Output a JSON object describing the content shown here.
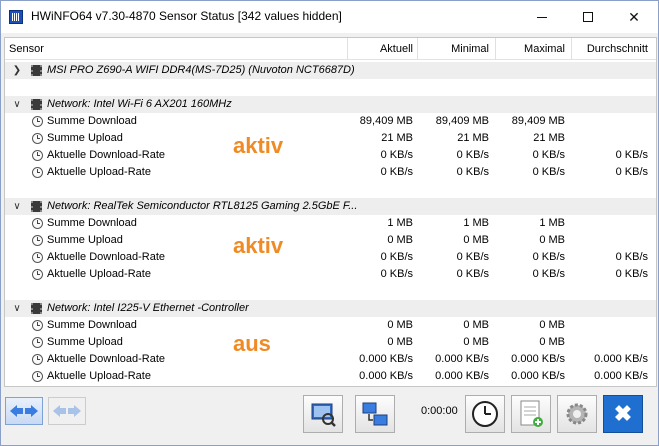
{
  "window": {
    "title": "HWiNFO64 v7.30-4870 Sensor Status [342 values hidden]"
  },
  "columns": {
    "sensor": "Sensor",
    "current": "Aktuell",
    "minimum": "Minimal",
    "maximum": "Maximal",
    "average": "Durchschnitt"
  },
  "groups": [
    {
      "name": "MSI PRO Z690-A WIFI DDR4(MS-7D25) (Nuvoton NCT6687D)",
      "expanded": false,
      "rows": []
    },
    {
      "name": "Network: Intel Wi-Fi 6 AX201 160MHz",
      "expanded": true,
      "rows": [
        {
          "label": "Summe Download",
          "cur": "89,409 MB",
          "min": "89,409 MB",
          "max": "89,409 MB",
          "avg": ""
        },
        {
          "label": "Summe Upload",
          "cur": "21 MB",
          "min": "21 MB",
          "max": "21 MB",
          "avg": ""
        },
        {
          "label": "Aktuelle Download-Rate",
          "cur": "0 KB/s",
          "min": "0 KB/s",
          "max": "0 KB/s",
          "avg": "0 KB/s"
        },
        {
          "label": "Aktuelle Upload-Rate",
          "cur": "0 KB/s",
          "min": "0 KB/s",
          "max": "0 KB/s",
          "avg": "0 KB/s"
        }
      ]
    },
    {
      "name": "Network: RealTek Semiconductor RTL8125 Gaming 2.5GbE F...",
      "expanded": true,
      "rows": [
        {
          "label": "Summe Download",
          "cur": "1 MB",
          "min": "1 MB",
          "max": "1 MB",
          "avg": ""
        },
        {
          "label": "Summe Upload",
          "cur": "0 MB",
          "min": "0 MB",
          "max": "0 MB",
          "avg": ""
        },
        {
          "label": "Aktuelle Download-Rate",
          "cur": "0 KB/s",
          "min": "0 KB/s",
          "max": "0 KB/s",
          "avg": "0 KB/s"
        },
        {
          "label": "Aktuelle Upload-Rate",
          "cur": "0 KB/s",
          "min": "0 KB/s",
          "max": "0 KB/s",
          "avg": "0 KB/s"
        }
      ]
    },
    {
      "name": "Network: Intel I225-V Ethernet -Controller",
      "expanded": true,
      "rows": [
        {
          "label": "Summe Download",
          "cur": "0 MB",
          "min": "0 MB",
          "max": "0 MB",
          "avg": ""
        },
        {
          "label": "Summe Upload",
          "cur": "0 MB",
          "min": "0 MB",
          "max": "0 MB",
          "avg": ""
        },
        {
          "label": "Aktuelle Download-Rate",
          "cur": "0.000 KB/s",
          "min": "0.000 KB/s",
          "max": "0.000 KB/s",
          "avg": "0.000 KB/s"
        },
        {
          "label": "Aktuelle Upload-Rate",
          "cur": "0.000 KB/s",
          "min": "0.000 KB/s",
          "max": "0.000 KB/s",
          "avg": "0.000 KB/s"
        }
      ]
    }
  ],
  "annotations": [
    "aktiv",
    "aktiv",
    "aus"
  ],
  "toolbar": {
    "elapsed_time": "0:00:00",
    "icons": [
      "arrows-both-icon",
      "arrows-disabled-icon",
      "report-icon",
      "network-icon",
      "clock-icon",
      "add-log-icon",
      "settings-icon",
      "close-icon"
    ]
  },
  "colors": {
    "annotation": "#f08a24",
    "group_row_bg": "#eeeeee",
    "close_button": "#1f6fd1"
  }
}
